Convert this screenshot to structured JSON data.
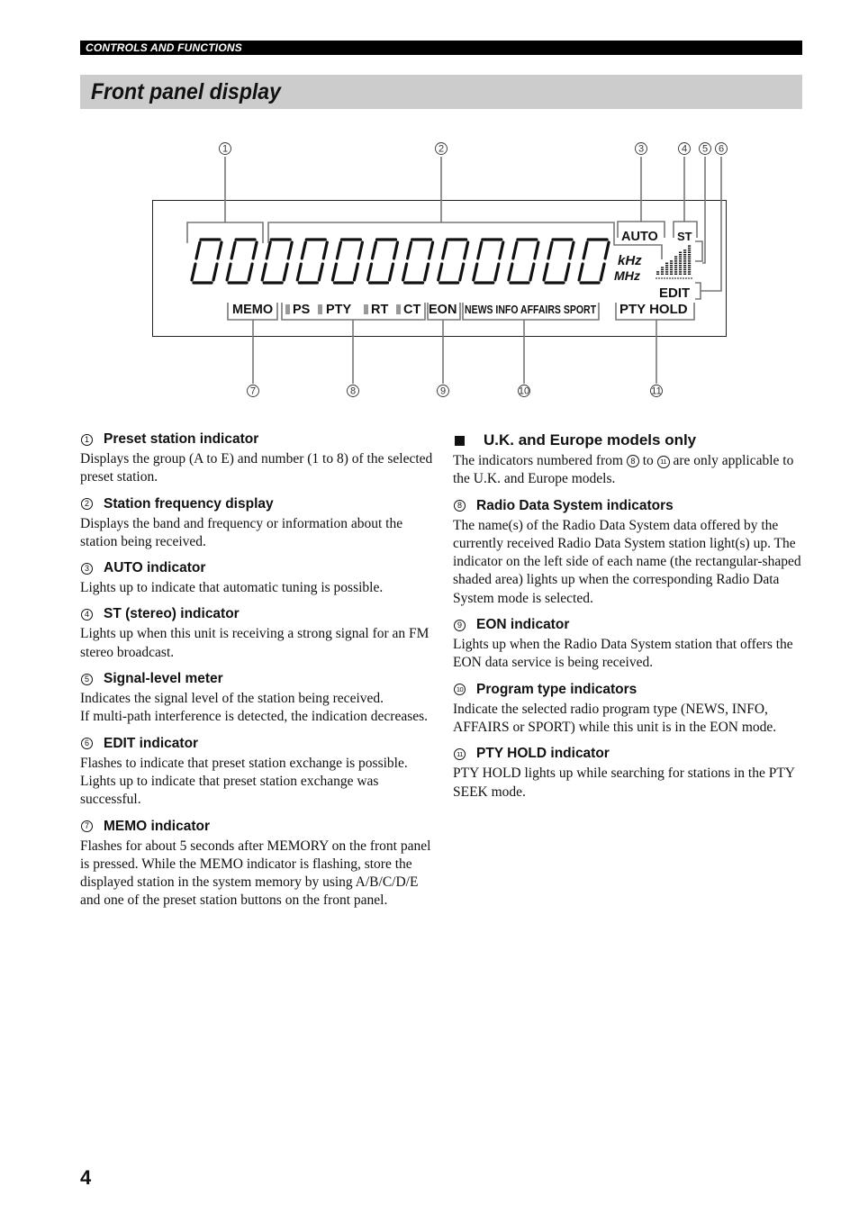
{
  "header": {
    "section_label": "CONTROLS AND FUNCTIONS",
    "page_title": "Front panel display"
  },
  "diagram": {
    "callouts": [
      "1",
      "2",
      "3",
      "4",
      "5",
      "6",
      "7",
      "8",
      "9",
      "10",
      "11"
    ],
    "display": {
      "preset_digits": 2,
      "frequency_digits": 10,
      "auto_label": "AUTO",
      "st_label": "ST",
      "khz_label": "kHz",
      "mhz_label": "MHz",
      "edit_label": "EDIT",
      "memo_label": "MEMO",
      "rds_labels": [
        "PS",
        "PTY",
        "RT",
        "CT"
      ],
      "eon_label": "EON",
      "program_types": "NEWS INFO AFFAIRS SPORT",
      "pty_hold_label": "PTY HOLD",
      "signal_meter_bars": 8
    }
  },
  "left_column": [
    {
      "num": "1",
      "title": "Preset station indicator",
      "body": "Displays the group (A to E) and number (1 to 8) of the selected preset station."
    },
    {
      "num": "2",
      "title": "Station frequency display",
      "body": "Displays the band and frequency or information about the station being received."
    },
    {
      "num": "3",
      "title": "AUTO indicator",
      "body": "Lights up to indicate that automatic tuning is possible."
    },
    {
      "num": "4",
      "title": "ST (stereo) indicator",
      "body": "Lights up when this unit is receiving a strong signal for an FM stereo broadcast."
    },
    {
      "num": "5",
      "title": "Signal-level meter",
      "body": "Indicates the signal level of the station being received.",
      "body2": "If multi-path interference is detected, the indication decreases."
    },
    {
      "num": "6",
      "title": "EDIT indicator",
      "body": "Flashes to indicate that preset station exchange is possible. Lights up to indicate that preset station exchange was successful."
    },
    {
      "num": "7",
      "title": "MEMO indicator",
      "body": "Flashes for about 5 seconds after MEMORY on the front panel is pressed. While the MEMO indicator is flashing, store the displayed station in the system memory by using A/B/C/D/E and one of the preset station buttons on the front panel."
    }
  ],
  "right_column": {
    "section_title": "U.K. and Europe models only",
    "section_intro_before": "The indicators numbered from",
    "section_intro_from": "8",
    "section_intro_mid": "to",
    "section_intro_to": "11",
    "section_intro_after": "are only applicable to the U.K. and Europe models.",
    "items": [
      {
        "num": "8",
        "title": "Radio Data System indicators",
        "body": "The name(s) of the Radio Data System data offered by the currently received Radio Data System station light(s) up. The indicator on the left side of each name (the rectangular-shaped shaded area) lights up when the corresponding Radio Data System mode is selected."
      },
      {
        "num": "9",
        "title": "EON indicator",
        "body": "Lights up when the Radio Data System station that offers the EON data service is being received."
      },
      {
        "num": "10",
        "title": "Program type indicators",
        "body": "Indicate the selected radio program type (NEWS, INFO, AFFAIRS or SPORT) while this unit is in the EON mode."
      },
      {
        "num": "11",
        "title": "PTY HOLD indicator",
        "body": "PTY HOLD lights up while searching for stations in the PTY SEEK mode."
      }
    ]
  },
  "footer": {
    "page_number": "4"
  }
}
